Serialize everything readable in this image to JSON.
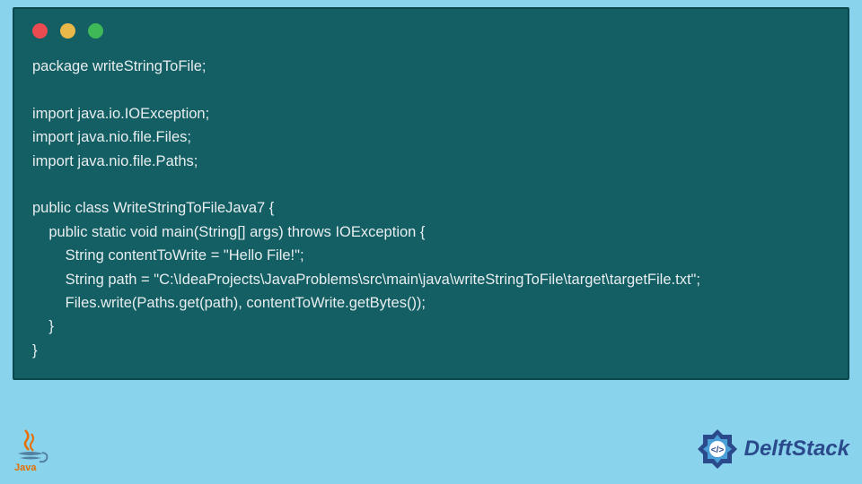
{
  "code": {
    "lines": [
      "package writeStringToFile;",
      "",
      "import java.io.IOException;",
      "import java.nio.file.Files;",
      "import java.nio.file.Paths;",
      "",
      "public class WriteStringToFileJava7 {",
      "    public static void main(String[] args) throws IOException {",
      "        String contentToWrite = \"Hello File!\";",
      "        String path = \"C:\\IdeaProjects\\JavaProblems\\src\\main\\java\\writeStringToFile\\target\\targetFile.txt\";",
      "        Files.write(Paths.get(path), contentToWrite.getBytes());",
      "    }",
      "}"
    ]
  },
  "footer": {
    "java_label": "Java",
    "brand": "DelftStack"
  }
}
